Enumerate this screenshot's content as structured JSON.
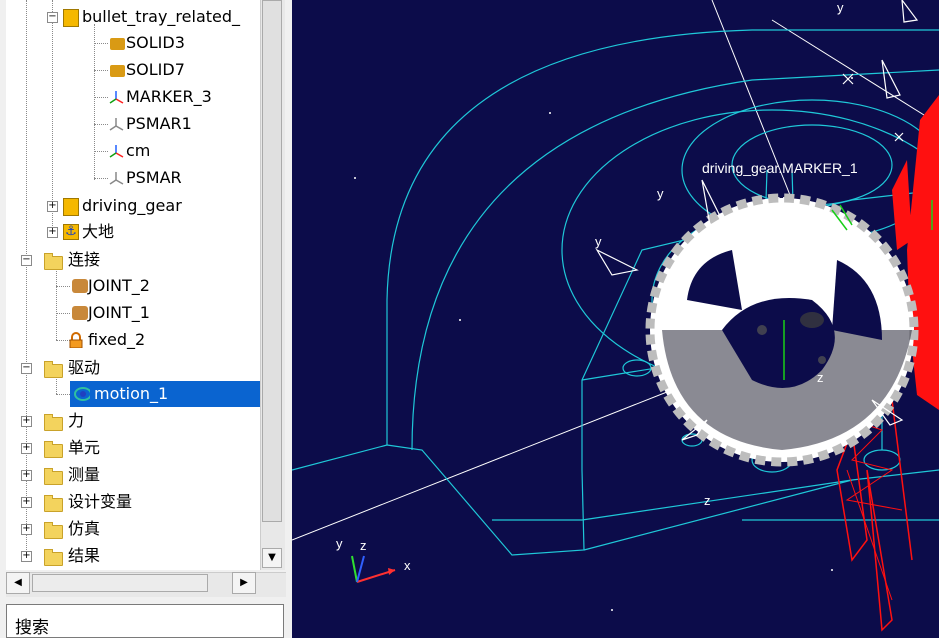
{
  "tree": {
    "items": [
      {
        "label": "bullet_tray_related_",
        "kind": "part"
      },
      {
        "label": "SOLID3",
        "kind": "solid"
      },
      {
        "label": "SOLID7",
        "kind": "solid"
      },
      {
        "label": "MARKER_3",
        "kind": "marker"
      },
      {
        "label": "PSMAR1",
        "kind": "marker"
      },
      {
        "label": "cm",
        "kind": "marker"
      },
      {
        "label": "PSMAR",
        "kind": "marker"
      },
      {
        "label": "driving_gear",
        "kind": "part"
      },
      {
        "label": "大地",
        "kind": "ground"
      },
      {
        "label": "连接",
        "kind": "folder"
      },
      {
        "label": "JOINT_2",
        "kind": "joint"
      },
      {
        "label": "JOINT_1",
        "kind": "joint"
      },
      {
        "label": "fixed_2",
        "kind": "fixed"
      },
      {
        "label": "驱动",
        "kind": "folder"
      },
      {
        "label": "motion_1",
        "kind": "motion",
        "selected": true
      },
      {
        "label": "力",
        "kind": "folder"
      },
      {
        "label": "单元",
        "kind": "folder"
      },
      {
        "label": "测量",
        "kind": "folder"
      },
      {
        "label": "设计变量",
        "kind": "folder"
      },
      {
        "label": "仿真",
        "kind": "folder"
      },
      {
        "label": "结果",
        "kind": "folder"
      }
    ]
  },
  "search": {
    "label": "搜索"
  },
  "viewport": {
    "marker_label": "driving_gear.MARKER_1",
    "axis_labels": {
      "x": "x",
      "y": "y",
      "z": "z"
    },
    "scene_labels": [
      "y",
      "y",
      "z",
      "z",
      "y",
      "y"
    ]
  },
  "colors": {
    "viewport_bg": "#0c0c4a",
    "wire": "#1fc8d8",
    "gear": "#ffffff",
    "red_part": "#ff1010",
    "selection": "#0a64d0"
  }
}
